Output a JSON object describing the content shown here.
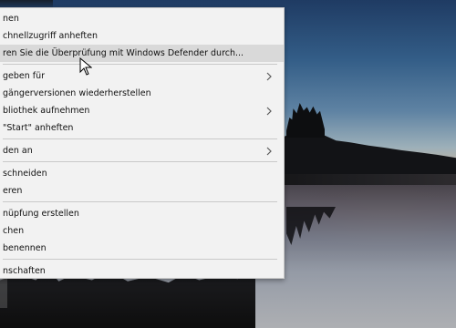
{
  "menu": {
    "items": [
      {
        "label": "nen",
        "has_submenu": false,
        "highlighted": false
      },
      {
        "label": "chnellzugriff anheften",
        "has_submenu": false,
        "highlighted": false
      },
      {
        "label": "ren Sie die Überprüfung mit Windows Defender durch...",
        "has_submenu": false,
        "highlighted": true
      },
      {
        "type": "separator"
      },
      {
        "label": "geben für",
        "has_submenu": true,
        "highlighted": false
      },
      {
        "label": "gängerversionen wiederherstellen",
        "has_submenu": false,
        "highlighted": false
      },
      {
        "label": "bliothek aufnehmen",
        "has_submenu": true,
        "highlighted": false
      },
      {
        "label": "\"Start\" anheften",
        "has_submenu": false,
        "highlighted": false
      },
      {
        "type": "separator"
      },
      {
        "label": "den an",
        "has_submenu": true,
        "highlighted": false
      },
      {
        "type": "separator"
      },
      {
        "label": "schneiden",
        "has_submenu": false,
        "highlighted": false
      },
      {
        "label": "eren",
        "has_submenu": false,
        "highlighted": false
      },
      {
        "type": "separator"
      },
      {
        "label": "nüpfung erstellen",
        "has_submenu": false,
        "highlighted": false
      },
      {
        "label": "chen",
        "has_submenu": false,
        "highlighted": false
      },
      {
        "label": "benennen",
        "has_submenu": false,
        "highlighted": false
      },
      {
        "type": "separator"
      },
      {
        "label": "nschaften",
        "has_submenu": false,
        "highlighted": false
      }
    ]
  },
  "colors": {
    "menu_background": "#f2f2f2",
    "menu_highlight": "#d9d9d9",
    "separator": "#c9c9c9"
  },
  "icons": {
    "submenu_arrow": "chevron-right-icon",
    "pointer": "mouse-pointer-icon"
  }
}
